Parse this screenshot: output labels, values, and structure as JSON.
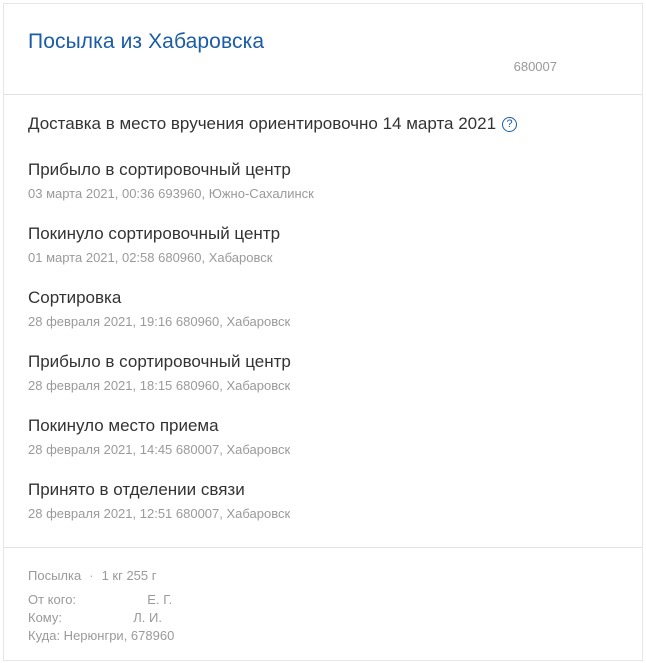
{
  "parcel": {
    "title": "Посылка из Хабаровска",
    "postcode": "680007",
    "estimate": "Доставка в место вручения ориентировочно 14 марта 2021",
    "help_icon": "question-circle-icon"
  },
  "events": [
    {
      "title": "Прибыло в сортировочный центр",
      "meta": "03 марта 2021, 00:36 693960, Южно-Сахалинск"
    },
    {
      "title": "Покинуло сортировочный центр",
      "meta": "01 марта 2021, 02:58 680960, Хабаровск"
    },
    {
      "title": "Сортировка",
      "meta": "28 февраля 2021, 19:16 680960, Хабаровск"
    },
    {
      "title": "Прибыло в сортировочный центр",
      "meta": "28 февраля 2021, 18:15 680960, Хабаровск"
    },
    {
      "title": "Покинуло место приема",
      "meta": "28 февраля 2021, 14:45 680007, Хабаровск"
    },
    {
      "title": "Принято в отделении связи",
      "meta": "28 февраля 2021, 12:51 680007, Хабаровск"
    }
  ],
  "details": {
    "type": "Посылка",
    "separator": "·",
    "weight": "1 кг 255 г",
    "from_label": "От кого:",
    "from_value": "Е. Г.",
    "to_label": "Кому:",
    "to_value": "Л. И.",
    "where": "Куда: Нерюнгри, 678960"
  },
  "colors": {
    "accent": "#1a5ca8",
    "text": "#333333",
    "muted": "#9a9a9a"
  }
}
